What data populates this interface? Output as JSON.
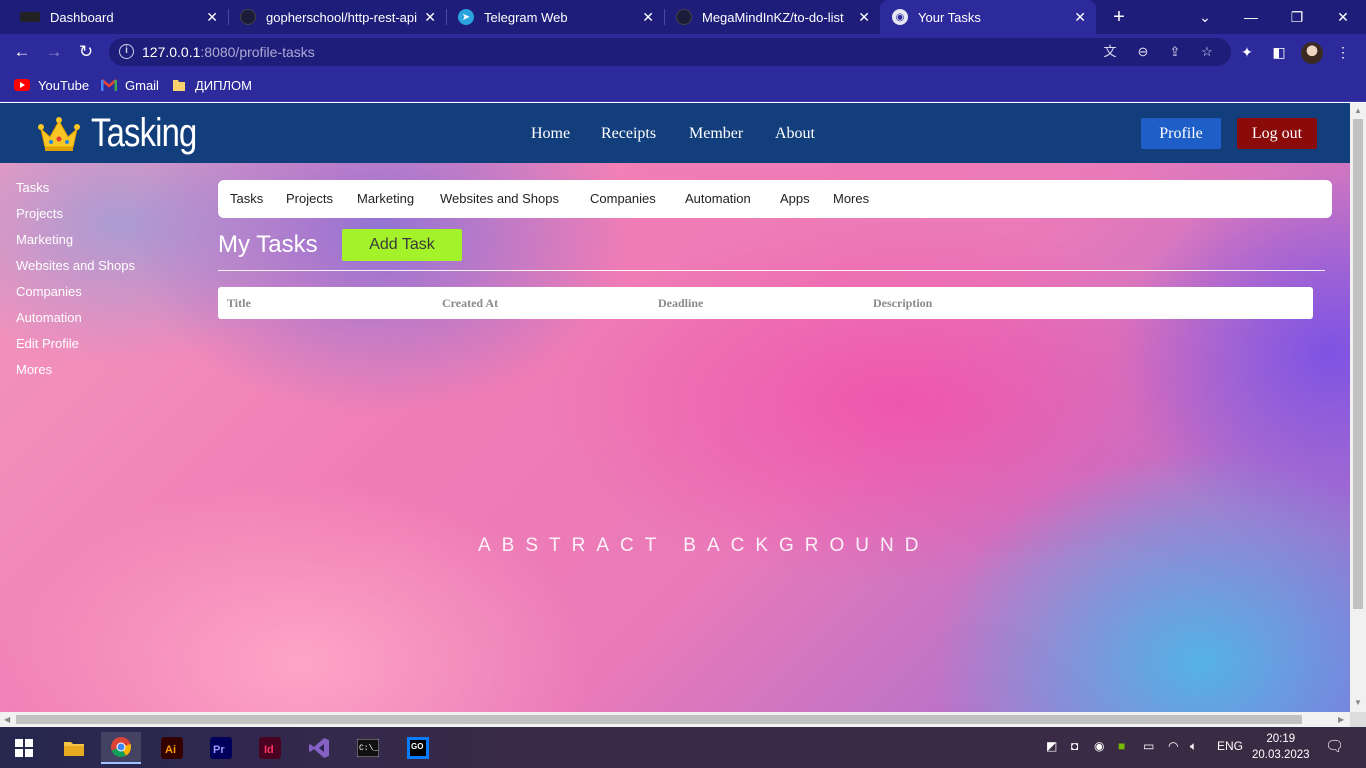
{
  "browser": {
    "tabs": [
      {
        "title": "Dashboard",
        "icon": "dashboard-favicon"
      },
      {
        "title": "gopherschool/http-rest-api",
        "icon": "github-favicon"
      },
      {
        "title": "Telegram Web",
        "icon": "telegram-favicon"
      },
      {
        "title": "MegaMindInKZ/to-do-list",
        "icon": "github-favicon"
      },
      {
        "title": "Your Tasks",
        "icon": "globe-favicon"
      }
    ],
    "url_host": "127.0.0.1",
    "url_rest": ":8080/profile-tasks",
    "bookmarks": [
      {
        "label": "YouTube",
        "icon": "youtube-icon"
      },
      {
        "label": "Gmail",
        "icon": "gmail-icon"
      },
      {
        "label": "ДИПЛОМ",
        "icon": "folder-icon"
      }
    ]
  },
  "header": {
    "brand": "Tasking",
    "nav": [
      "Home",
      "Receipts",
      "Member",
      "About"
    ],
    "profile_label": "Profile",
    "logout_label": "Log out"
  },
  "sidebar": {
    "items": [
      "Tasks",
      "Projects",
      "Marketing",
      "Websites and Shops",
      "Companies",
      "Automation",
      "Edit Profile",
      "Mores"
    ]
  },
  "subnav": {
    "items": [
      "Tasks",
      "Projects",
      "Marketing",
      "Websites and Shops",
      "Companies",
      "Automation",
      "Apps",
      "Mores"
    ]
  },
  "main": {
    "title": "My Tasks",
    "add_task_label": "Add Task",
    "table_headers": [
      "Title",
      "Created At",
      "Deadline",
      "Description"
    ],
    "background_text": "ABSTRACT BACKGROUND"
  },
  "taskbar": {
    "lang": "ENG",
    "time": "20:19",
    "date": "20.03.2023"
  },
  "colors": {
    "header_bg": "#123e7c",
    "profile_button": "#1e5ec7",
    "logout_button": "#8b0a0a",
    "add_task_button": "#a4f22a",
    "tabbar_bg": "#1f1d7a"
  }
}
